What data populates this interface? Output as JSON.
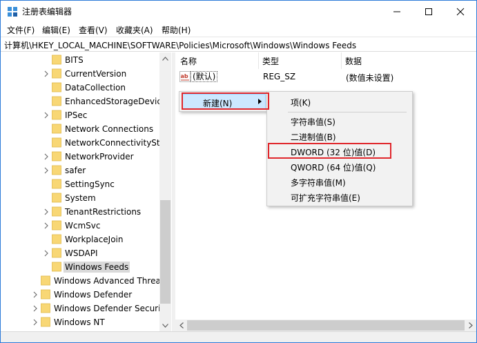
{
  "window": {
    "title": "注册表编辑器",
    "border_color": "#2b79d8"
  },
  "titlebar_buttons": {
    "minimize_icon": "minimize-icon",
    "maximize_icon": "maximize-icon",
    "close_icon": "close-icon"
  },
  "menubar": {
    "items": [
      "文件(F)",
      "编辑(E)",
      "查看(V)",
      "收藏夹(A)",
      "帮助(H)"
    ]
  },
  "address": {
    "path": "计算机\\HKEY_LOCAL_MACHINE\\SOFTWARE\\Policies\\Microsoft\\Windows\\Windows Feeds"
  },
  "tree": {
    "items": [
      {
        "label": "BITS",
        "expandable": false,
        "level": 2
      },
      {
        "label": "CurrentVersion",
        "expandable": true,
        "level": 2
      },
      {
        "label": "DataCollection",
        "expandable": false,
        "level": 2
      },
      {
        "label": "EnhancedStorageDevices",
        "expandable": false,
        "level": 2
      },
      {
        "label": "IPSec",
        "expandable": true,
        "level": 2
      },
      {
        "label": "Network Connections",
        "expandable": false,
        "level": 2
      },
      {
        "label": "NetworkConnectivityStatusIndicator",
        "expandable": false,
        "level": 2
      },
      {
        "label": "NetworkProvider",
        "expandable": true,
        "level": 2
      },
      {
        "label": "safer",
        "expandable": true,
        "level": 2
      },
      {
        "label": "SettingSync",
        "expandable": false,
        "level": 2
      },
      {
        "label": "System",
        "expandable": false,
        "level": 2
      },
      {
        "label": "TenantRestrictions",
        "expandable": true,
        "level": 2
      },
      {
        "label": "WcmSvc",
        "expandable": true,
        "level": 2
      },
      {
        "label": "WorkplaceJoin",
        "expandable": false,
        "level": 2
      },
      {
        "label": "WSDAPI",
        "expandable": true,
        "level": 2
      },
      {
        "label": "Windows Feeds",
        "expandable": false,
        "level": 2,
        "selected": true
      },
      {
        "label": "Windows Advanced Threat Protection",
        "expandable": false,
        "level": 1
      },
      {
        "label": "Windows Defender",
        "expandable": true,
        "level": 1
      },
      {
        "label": "Windows Defender Security Center",
        "expandable": true,
        "level": 1
      },
      {
        "label": "Windows NT",
        "expandable": true,
        "level": 1
      }
    ]
  },
  "list": {
    "headers": [
      "名称",
      "类型",
      "数据"
    ],
    "rows": [
      {
        "name": "(默认)",
        "type": "REG_SZ",
        "data": "(数值未设置)",
        "icon": "string-value-icon"
      }
    ]
  },
  "context_menu": {
    "new_label": "新建(N)",
    "submenu_arrow": "chevron-right-icon",
    "submenu": [
      "项(K)",
      "字符串值(S)",
      "二进制值(B)",
      "DWORD (32 位)值(D)",
      "QWORD (64 位)值(Q)",
      "多字符串值(M)",
      "可扩充字符串值(E)"
    ]
  },
  "colors": {
    "highlight_red": "#e0262b",
    "selection_blue": "#cce8ff",
    "folder_yellow": "#f8d775"
  }
}
